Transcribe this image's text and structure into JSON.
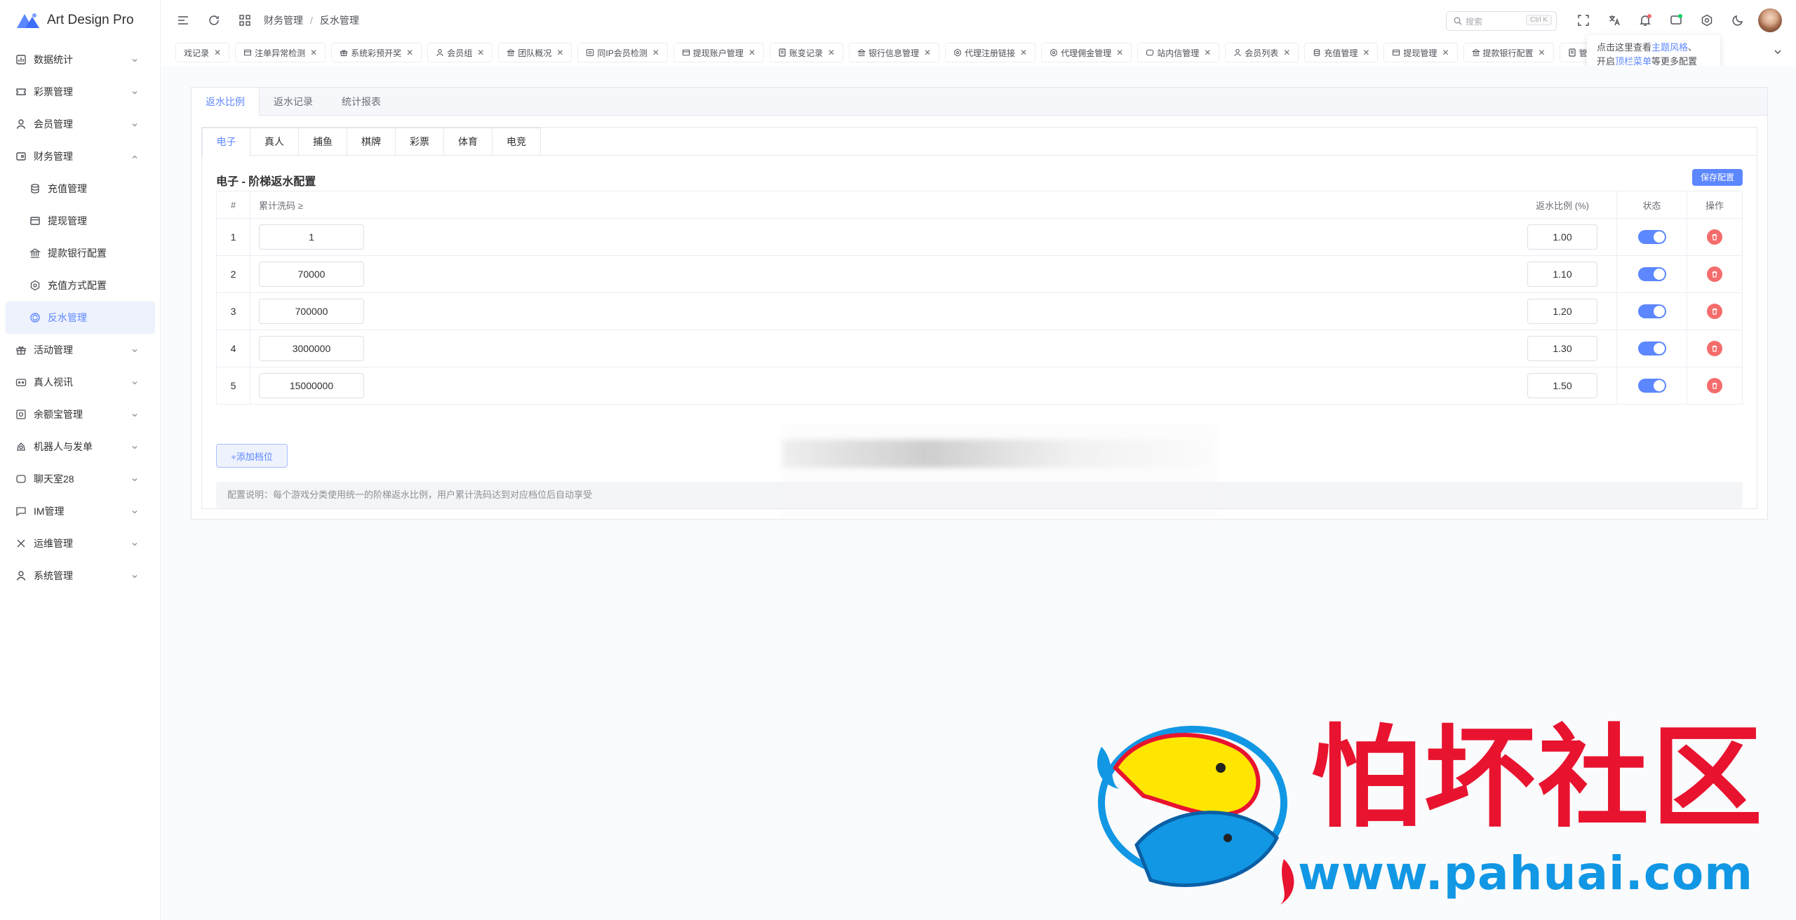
{
  "app": {
    "logo_text": "Art Design Pro"
  },
  "sidebar": {
    "items": [
      {
        "label": "数据统计",
        "icon": "chart-icon"
      },
      {
        "label": "彩票管理",
        "icon": "ticket-icon"
      },
      {
        "label": "会员管理",
        "icon": "user-icon"
      },
      {
        "label": "财务管理",
        "icon": "wallet-icon",
        "expanded": true
      }
    ],
    "finance_children": [
      {
        "label": "充值管理",
        "icon": "coins-icon"
      },
      {
        "label": "提现管理",
        "icon": "card-icon"
      },
      {
        "label": "提款银行配置",
        "icon": "bank-icon"
      },
      {
        "label": "充值方式配置",
        "icon": "gear-icon"
      },
      {
        "label": "反水管理",
        "icon": "refresh-icon",
        "active": true
      }
    ],
    "items_after": [
      {
        "label": "活动管理",
        "icon": "gift-icon"
      },
      {
        "label": "真人视讯",
        "icon": "video-icon"
      },
      {
        "label": "余额宝管理",
        "icon": "safe-icon"
      },
      {
        "label": "机器人与发单",
        "icon": "robot-icon"
      },
      {
        "label": "聊天室28",
        "icon": "chat-icon"
      },
      {
        "label": "IM管理",
        "icon": "message-icon"
      },
      {
        "label": "运维管理",
        "icon": "tools-icon"
      },
      {
        "label": "系统管理",
        "icon": "user-icon"
      }
    ]
  },
  "header": {
    "breadcrumb": [
      "财务管理",
      "反水管理"
    ],
    "breadcrumb_sep": "/",
    "search_placeholder": "搜索",
    "search_shortcut": "Ctrl K"
  },
  "page_tabs": [
    "戏记录",
    "注单异常检测",
    "系统彩预开奖",
    "会员组",
    "团队概况",
    "同IP会员检测",
    "提现账户管理",
    "账变记录",
    "银行信息管理",
    "代理注册链接",
    "代理佣金管理",
    "站内信管理",
    "会员列表",
    "充值管理",
    "提现管理",
    "提款银行配置",
    "管理"
  ],
  "tooltip": {
    "line1_pre": "点击这里查看",
    "line1_hl": "主题风格",
    "line1_post": "、",
    "line2_pre": "开启",
    "line2_hl": "顶栏菜单",
    "line2_post": "等更多配置"
  },
  "content": {
    "top_tabs": [
      "返水比例",
      "返水记录",
      "统计报表"
    ],
    "sub_tabs": [
      "电子",
      "真人",
      "捕鱼",
      "棋牌",
      "彩票",
      "体育",
      "电竞"
    ],
    "section_title": "电子 - 阶梯返水配置",
    "save_button": "保存配置",
    "table_headers": {
      "idx": "#",
      "flow": "累计洗码 ≥",
      "rate": "返水比例 (%)",
      "status": "状态",
      "op": "操作"
    },
    "rows": [
      {
        "idx": "1",
        "flow": "1",
        "rate": "1.00",
        "enabled": true
      },
      {
        "idx": "2",
        "flow": "70000",
        "rate": "1.10",
        "enabled": true
      },
      {
        "idx": "3",
        "flow": "700000",
        "rate": "1.20",
        "enabled": true
      },
      {
        "idx": "4",
        "flow": "3000000",
        "rate": "1.30",
        "enabled": true
      },
      {
        "idx": "5",
        "flow": "15000000",
        "rate": "1.50",
        "enabled": true
      }
    ],
    "add_button": "+添加档位",
    "note": "配置说明：每个游戏分类使用统一的阶梯返水比例，用户累计洗码达到对应档位后自动享受"
  },
  "watermark": {
    "title": "怕坏社区",
    "url": "www.pahuai.com"
  },
  "colors": {
    "accent": "#5d87ff",
    "danger": "#f56c6c",
    "watermark_red": "#e8132f",
    "watermark_blue": "#1197e4"
  }
}
